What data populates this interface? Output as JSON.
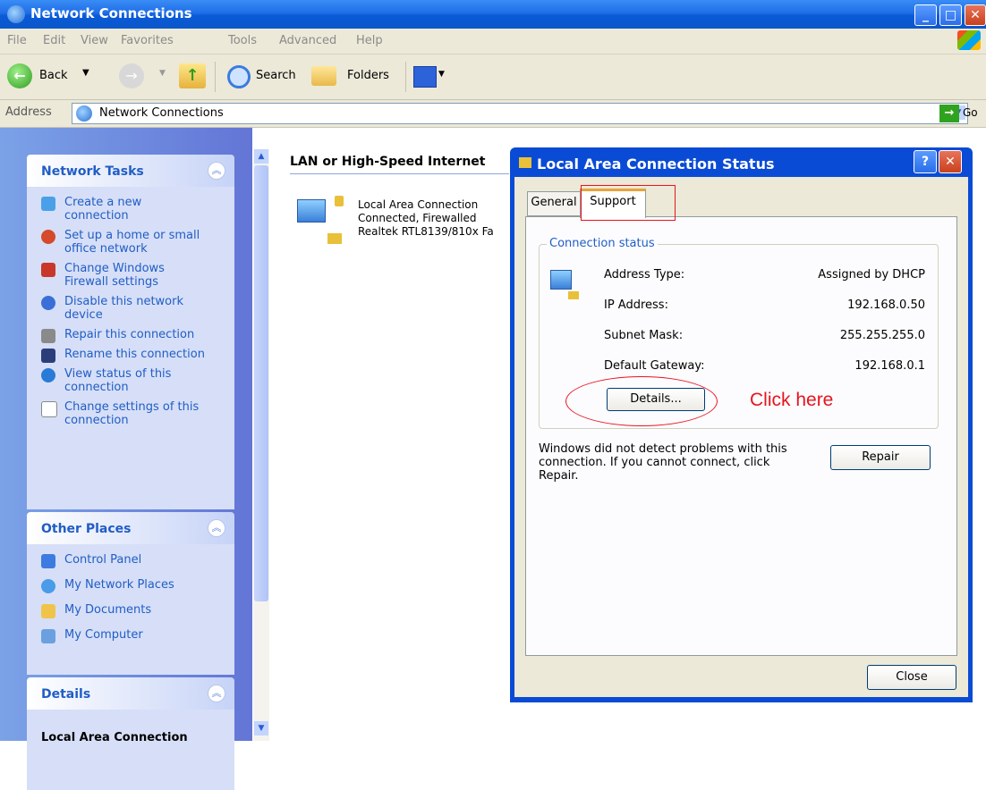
{
  "window": {
    "title": "Network Connections"
  },
  "menu": [
    "File",
    "Edit",
    "View",
    "Favorites",
    "Tools",
    "Advanced",
    "Help"
  ],
  "toolbar": {
    "back": "Back",
    "search": "Search",
    "folders": "Folders"
  },
  "address": {
    "label": "Address",
    "value": "Network Connections",
    "go": "Go"
  },
  "sidebar": {
    "network_tasks": {
      "title": "Network Tasks",
      "items": [
        {
          "label": "Create a new connection"
        },
        {
          "label": "Set up a home or small office network"
        },
        {
          "label": "Change Windows Firewall settings"
        },
        {
          "label": "Disable this network device"
        },
        {
          "label": "Repair this connection"
        },
        {
          "label": "Rename this connection"
        },
        {
          "label": "View status of this connection"
        },
        {
          "label": "Change settings of this connection"
        }
      ]
    },
    "other_places": {
      "title": "Other Places",
      "items": [
        {
          "label": "Control Panel"
        },
        {
          "label": "My Network Places"
        },
        {
          "label": "My Documents"
        },
        {
          "label": "My Computer"
        }
      ]
    },
    "details": {
      "title": "Details",
      "name": "Local Area Connection"
    }
  },
  "main": {
    "group_title": "LAN or High-Speed Internet",
    "connection": {
      "name": "Local Area Connection",
      "status": "Connected, Firewalled",
      "device": "Realtek RTL8139/810x Fa"
    }
  },
  "dialog": {
    "title": "Local Area Connection Status",
    "tabs": [
      "General",
      "Support"
    ],
    "group_label": "Connection status",
    "fields": [
      {
        "label": "Address Type:",
        "value": "Assigned by DHCP"
      },
      {
        "label": "IP Address:",
        "value": "192.168.0.50"
      },
      {
        "label": "Subnet Mask:",
        "value": "255.255.255.0"
      },
      {
        "label": "Default Gateway:",
        "value": "192.168.0.1"
      }
    ],
    "details_button": "Details...",
    "annotation": "Click here",
    "message": "Windows did not detect problems with this connection. If you cannot connect, click Repair.",
    "repair_button": "Repair",
    "close_button": "Close"
  },
  "colors": {
    "xp_blue": "#0a4bd6",
    "task_link": "#215dc6",
    "annotation_red": "#e8141e"
  }
}
